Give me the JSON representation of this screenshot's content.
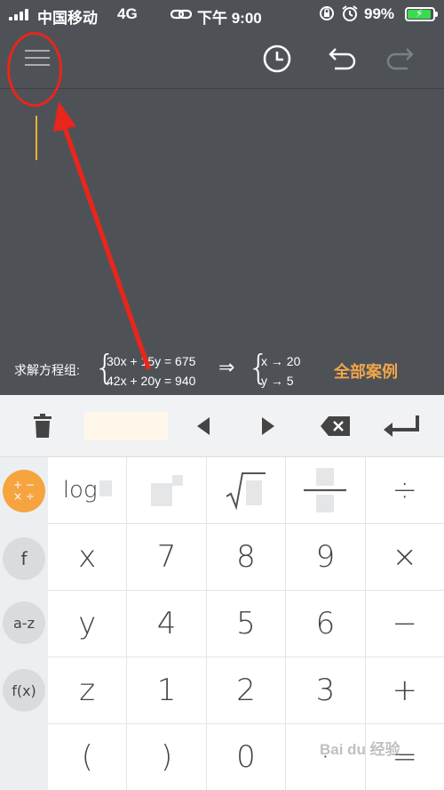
{
  "status_bar": {
    "carrier": "中国移动",
    "network": "4G",
    "time": "下午 9:00",
    "battery_percent": "99%",
    "battery_level": 0.99,
    "icons": [
      "signal-icon",
      "link-icon",
      "orientation-lock-icon",
      "alarm-icon",
      "battery-charging-icon"
    ]
  },
  "toolbar": {
    "icons": [
      "menu-icon",
      "history-icon",
      "undo-icon",
      "redo-icon"
    ]
  },
  "example": {
    "label": "求解方程组:",
    "eq1": "30x + 15y = 675",
    "eq2": "42x + 20y = 940",
    "implies": "⇒",
    "sol1": "x → 20",
    "sol2": "y → 5",
    "all_examples": "全部案例"
  },
  "edit_bar": {
    "icons": [
      "trash-icon",
      "left-arrow-icon",
      "right-arrow-icon",
      "backspace-icon",
      "enter-icon"
    ]
  },
  "side_keys": {
    "ops": "+ −\n× ÷",
    "f": "f",
    "az": "a-z",
    "fx": "f(x)"
  },
  "keys": {
    "log": "log",
    "divide": "÷",
    "x": "x",
    "seven": "7",
    "eight": "8",
    "nine": "9",
    "times": "×",
    "y": "y",
    "four": "4",
    "five": "5",
    "six": "6",
    "minus": "−",
    "z": "z",
    "one": "1",
    "two": "2",
    "three": "3",
    "plus": "+",
    "lparen": "(",
    "rparen": ")",
    "zero": "0",
    "dot": "·",
    "equals": "="
  },
  "watermark": "Bai du 经验",
  "colors": {
    "background": "#4e5257",
    "cursor": "#e9b233",
    "accent_orange": "#f6a440",
    "link_orange": "#f2a64a",
    "annotation_red": "#e8261c",
    "battery_green": "#3adb4d"
  }
}
